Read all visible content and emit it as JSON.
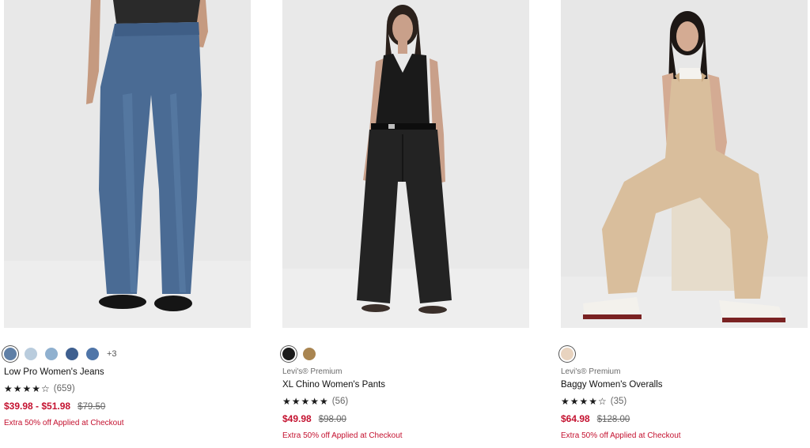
{
  "products": [
    {
      "brand": "",
      "name": "Low Pro Women's Jeans",
      "rating_stars": "★★★★☆",
      "rating_count": "(659)",
      "rating_value": 4,
      "price_sale": "$39.98 - $51.98",
      "price_original": "$79.50",
      "promo": "Extra 50% off Applied at Checkout",
      "image_alt": "Woman wearing medium-wash wide-leg jeans with black flats",
      "swatches": [
        {
          "name": "medium-blue",
          "color": "#5f7fa6",
          "selected": true
        },
        {
          "name": "light-blue",
          "color": "#b9ccdd"
        },
        {
          "name": "sky-blue",
          "color": "#8fb0cf"
        },
        {
          "name": "navy-blue",
          "color": "#3e5f8f"
        },
        {
          "name": "denim-blue",
          "color": "#4f75a8"
        }
      ],
      "more_colors": "+3"
    },
    {
      "brand": "Levi's® Premium",
      "name": "XL Chino Women's Pants",
      "rating_stars": "★★★★★",
      "rating_count": "(56)",
      "rating_value": 5,
      "price_sale": "$49.98",
      "price_original": "$98.00",
      "promo": "Extra 50% off Applied at Checkout",
      "image_alt": "Woman in black tank top and black wide-leg chino pants",
      "swatches": [
        {
          "name": "black",
          "color": "#1b1b1b",
          "selected": true
        },
        {
          "name": "tan",
          "color": "#a98551"
        }
      ],
      "more_colors": ""
    },
    {
      "brand": "Levi's® Premium",
      "name": "Baggy Women's Overalls",
      "rating_stars": "★★★★☆",
      "rating_count": "(35)",
      "rating_value": 4,
      "price_sale": "$64.98",
      "price_original": "$128.00",
      "promo": "Extra 50% off Applied at Checkout",
      "image_alt": "Woman seated on a block wearing beige baggy overalls",
      "swatches": [
        {
          "name": "beige",
          "color": "#e8d3bf",
          "selected": true
        }
      ],
      "more_colors": ""
    }
  ],
  "colors": {
    "sale_red": "#c41230",
    "photo_bg": "#ececec"
  }
}
